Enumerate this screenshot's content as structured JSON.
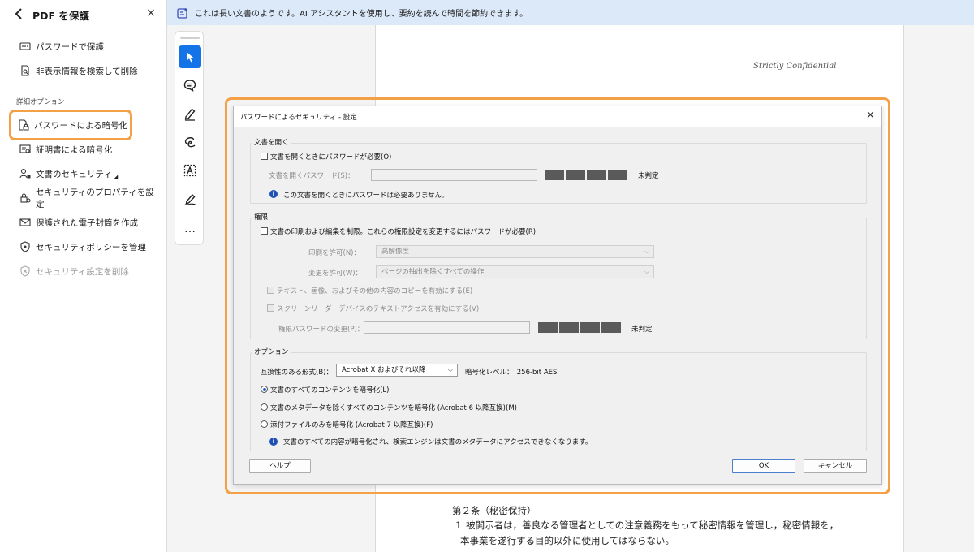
{
  "panel": {
    "title": "PDF を保護",
    "close": "×",
    "items": [
      {
        "label": "パスワードで保護"
      },
      {
        "label": "非表示情報を検索して削除"
      }
    ],
    "section_label": "詳細オプション",
    "advanced": [
      {
        "label": "パスワードによる暗号化"
      },
      {
        "label": "証明書による暗号化"
      },
      {
        "label": "文書のセキュリティ"
      },
      {
        "label": "セキュリティのプロパティを設定"
      },
      {
        "label": "保護された電子封筒を作成"
      },
      {
        "label": "セキュリティポリシーを管理"
      },
      {
        "label": "セキュリティ設定を削除"
      }
    ]
  },
  "banner": {
    "text": "これは長い文書のようです。AI アシスタントを使用し、要約を読んで時間を節約できます。"
  },
  "toolbar": {
    "more": "…"
  },
  "document": {
    "confidential": "Strictly Confidential",
    "article_title": "第２条（秘密保持）",
    "line1": "１ 被開示者は，善良なる管理者としての注意義務をもって秘密情報を管理し，秘密情報を，",
    "line2": "本事業を遂行する目的以外に使用してはならない。"
  },
  "dialog": {
    "title": "パスワードによるセキュリティ - 設定",
    "close": "✕",
    "open_group": {
      "label": "文書を開く",
      "require_pw": "文書を開くときにパスワードが必要(O)",
      "pw_label": "文書を開くパスワード(S)：",
      "strength": "未判定",
      "info": "この文書を開くときにパスワードは必要ありません。"
    },
    "perm_group": {
      "label": "権限",
      "restrict": "文書の印刷および編集を制限。これらの権限設定を変更するにはパスワードが必要(R)",
      "print_label": "印刷を許可(N)：",
      "print_value": "高解像度",
      "change_label": "変更を許可(W)：",
      "change_value": "ページの抽出を除くすべての操作",
      "copy_text": "テキスト、画像、およびその他の内容のコピーを有効にする(E)",
      "screen_reader": "スクリーンリーダーデバイスのテキストアクセスを有効にする(V)",
      "perm_pw_label": "権限パスワードの変更(P)：",
      "strength": "未判定"
    },
    "options_group": {
      "label": "オプション",
      "compat_label": "互換性のある形式(B)：",
      "compat_value": "Acrobat X およびそれ以降",
      "enc_level": "暗号化レベル：　256-bit AES",
      "radio_all": "文書のすべてのコンテンツを暗号化(L)",
      "radio_except_meta": "文書のメタデータを除くすべてのコンテンツを暗号化 (Acrobat 6 以降互換)(M)",
      "radio_attachments": "添付ファイルのみを暗号化 (Acrobat 7 以降互換)(F)",
      "info": "文書のすべての内容が暗号化され、検索エンジンは文書のメタデータにアクセスできなくなります。"
    },
    "help": "ヘルプ",
    "ok": "OK",
    "cancel": "キャンセル"
  },
  "colors": {
    "highlight": "#f3a047",
    "accent": "#1473e6",
    "banner_bg": "#dce9f9"
  }
}
